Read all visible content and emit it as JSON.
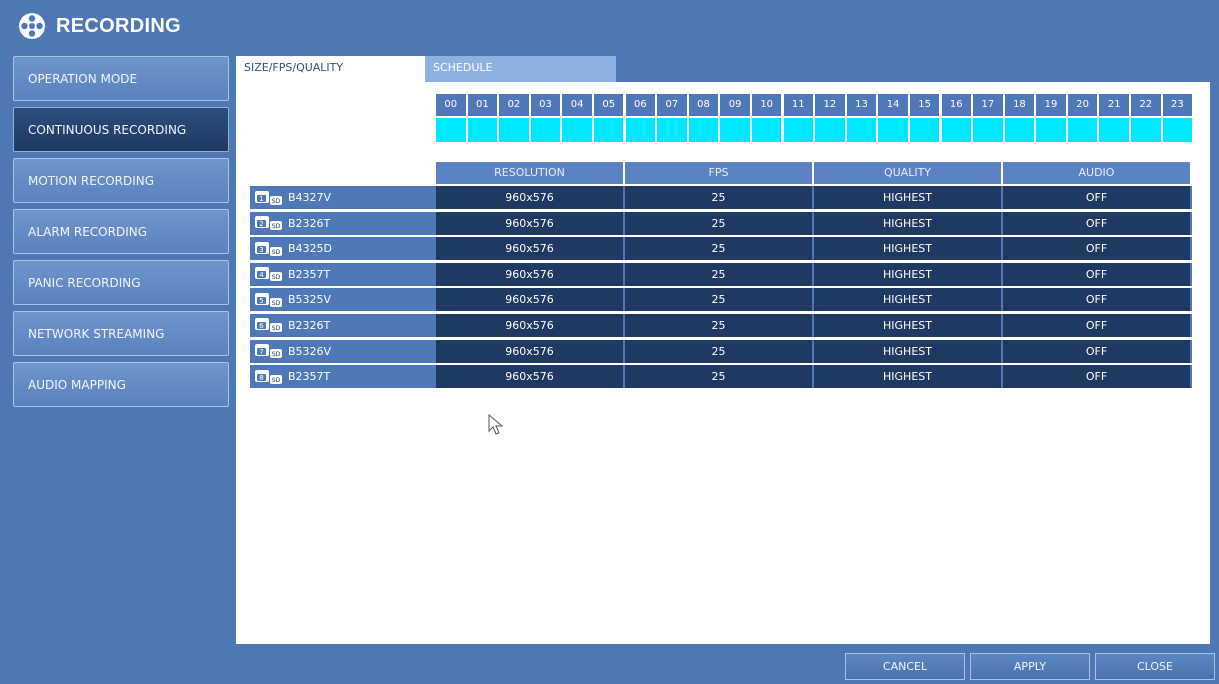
{
  "title": "RECORDING",
  "sidebar": {
    "items": [
      {
        "label": "OPERATION MODE",
        "active": false
      },
      {
        "label": "CONTINUOUS RECORDING",
        "active": true
      },
      {
        "label": "MOTION RECORDING",
        "active": false
      },
      {
        "label": "ALARM RECORDING",
        "active": false
      },
      {
        "label": "PANIC RECORDING",
        "active": false
      },
      {
        "label": "NETWORK STREAMING",
        "active": false
      },
      {
        "label": "AUDIO MAPPING",
        "active": false
      }
    ]
  },
  "tabs": [
    {
      "label": "SIZE/FPS/QUALITY",
      "active": true
    },
    {
      "label": "SCHEDULE",
      "active": false
    }
  ],
  "hours": [
    "00",
    "01",
    "02",
    "03",
    "04",
    "05",
    "06",
    "07",
    "08",
    "09",
    "10",
    "11",
    "12",
    "13",
    "14",
    "15",
    "16",
    "17",
    "18",
    "19",
    "20",
    "21",
    "22",
    "23"
  ],
  "columns": [
    "RESOLUTION",
    "FPS",
    "QUALITY",
    "AUDIO"
  ],
  "channels": [
    {
      "num": "1",
      "name": "B4327V",
      "resolution": "960x576",
      "fps": "25",
      "quality": "HIGHEST",
      "audio": "OFF"
    },
    {
      "num": "2",
      "name": "B2326T",
      "resolution": "960x576",
      "fps": "25",
      "quality": "HIGHEST",
      "audio": "OFF"
    },
    {
      "num": "3",
      "name": "B4325D",
      "resolution": "960x576",
      "fps": "25",
      "quality": "HIGHEST",
      "audio": "OFF"
    },
    {
      "num": "4",
      "name": "B2357T",
      "resolution": "960x576",
      "fps": "25",
      "quality": "HIGHEST",
      "audio": "OFF"
    },
    {
      "num": "5",
      "name": "B5325V",
      "resolution": "960x576",
      "fps": "25",
      "quality": "HIGHEST",
      "audio": "OFF"
    },
    {
      "num": "6",
      "name": "B2326T",
      "resolution": "960x576",
      "fps": "25",
      "quality": "HIGHEST",
      "audio": "OFF"
    },
    {
      "num": "7",
      "name": "B5326V",
      "resolution": "960x576",
      "fps": "25",
      "quality": "HIGHEST",
      "audio": "OFF"
    },
    {
      "num": "8",
      "name": "B2357T",
      "resolution": "960x576",
      "fps": "25",
      "quality": "HIGHEST",
      "audio": "OFF"
    }
  ],
  "cam_badge": "SD",
  "buttons": {
    "cancel": "CANCEL",
    "apply": "APPLY",
    "close": "CLOSE"
  },
  "colors": {
    "background": "#4d78b4",
    "active_item": "#1e3a63",
    "schedule_cell": "#00e8ff",
    "table_cell": "#1e3a62"
  },
  "icons": {
    "title": "film-reel-icon",
    "camera": "camera-icon",
    "cursor": "mouse-pointer-icon"
  }
}
